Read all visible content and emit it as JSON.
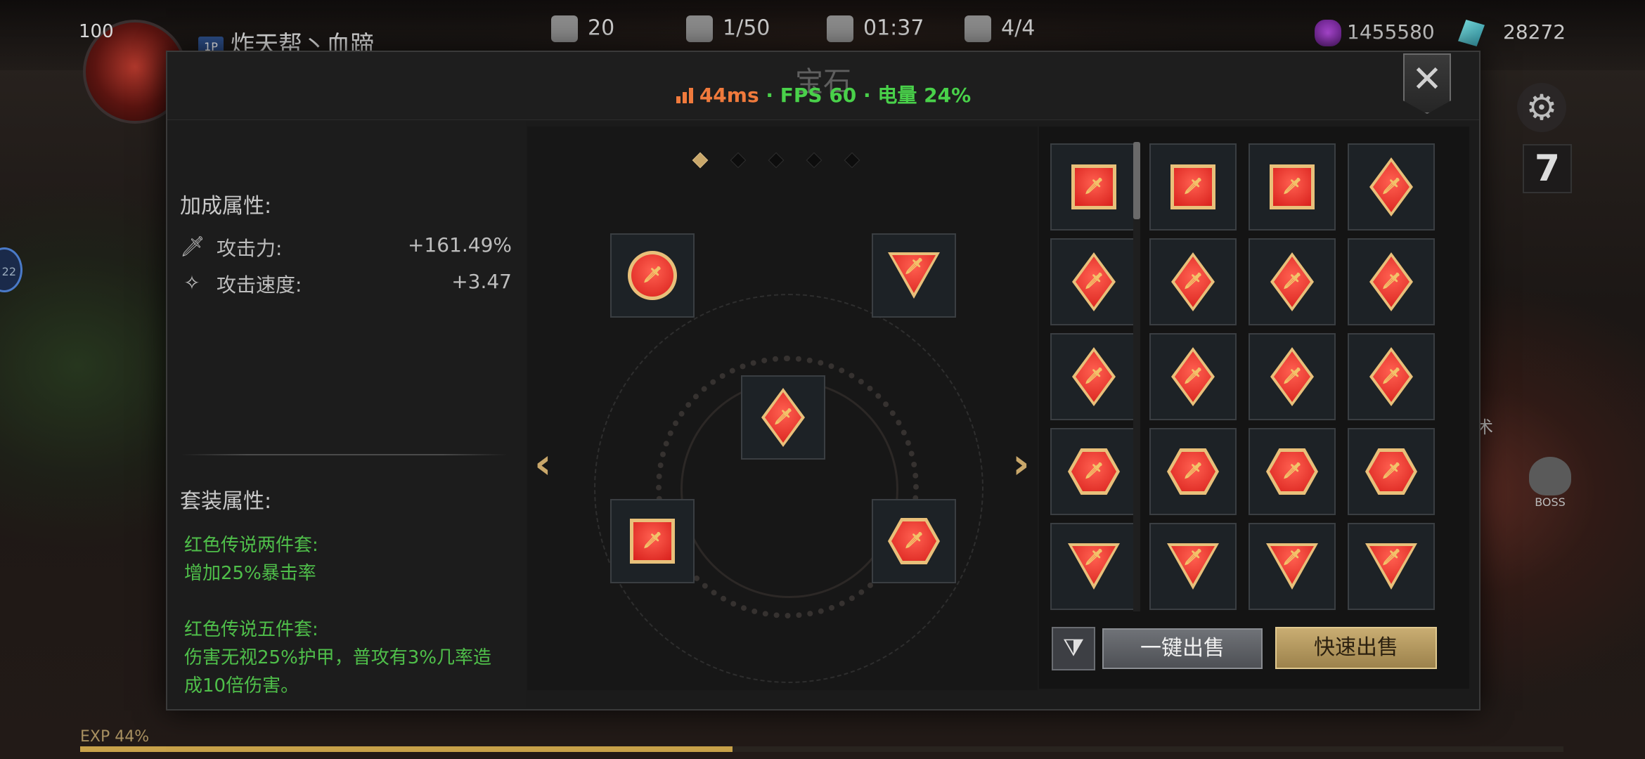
{
  "hud": {
    "level": "100",
    "guild_tag": "1P",
    "guild_name": "炸天帮丶血蹄",
    "stats": [
      {
        "icon": "fist-icon",
        "value": "20"
      },
      {
        "icon": "heart-icon",
        "value": "1/50"
      },
      {
        "icon": "crossed-swords-icon",
        "value": "01:37"
      },
      {
        "icon": "demon-mask-icon",
        "value": "4/4"
      }
    ],
    "currency_purple": "1455580",
    "currency_teal": "28272",
    "side_number": "7",
    "boss_label": "BOSS",
    "skill_label": "术",
    "left_badge": "22",
    "exp_label": "EXP 44%",
    "exp_percent": 44
  },
  "modal": {
    "title": "宝石",
    "perf_ping": "44ms",
    "perf_rest": " · FPS 60 · 电量 24%",
    "close_label": "✕"
  },
  "bonus": {
    "title": "加成属性:",
    "stats": [
      {
        "icon": "sword-icon",
        "name": "攻击力:",
        "value": "+161.49%"
      },
      {
        "icon": "winged-sword-icon",
        "name": "攻击速度:",
        "value": "+3.47"
      }
    ]
  },
  "set_bonus": {
    "title": "套装属性:",
    "entries": [
      {
        "name": "红色传说两件套:",
        "desc": "增加25%暴击率"
      },
      {
        "name": "红色传说五件套:",
        "desc": "伤害无视25%护甲，普攻有3%几率造\n成10倍伤害。"
      }
    ]
  },
  "socket": {
    "page_dots": 5,
    "active_dot": 0,
    "slots": [
      {
        "pos": "top-left",
        "shape": "circle"
      },
      {
        "pos": "top-right",
        "shape": "triangle"
      },
      {
        "pos": "center",
        "shape": "diamond"
      },
      {
        "pos": "bottom-left",
        "shape": "square"
      },
      {
        "pos": "bottom-right",
        "shape": "hexagon"
      }
    ],
    "prev_arrow": "‹",
    "next_arrow": "›"
  },
  "inventory": {
    "rows": [
      [
        "square",
        "square",
        "square",
        "diamond"
      ],
      [
        "diamond",
        "diamond",
        "diamond",
        "diamond"
      ],
      [
        "diamond",
        "diamond",
        "diamond",
        "diamond"
      ],
      [
        "hexagon",
        "hexagon",
        "hexagon",
        "hexagon"
      ],
      [
        "triangle",
        "triangle",
        "triangle",
        "triangle"
      ]
    ],
    "filter_icon": "filter-icon",
    "sell_all_label": "一键出售",
    "quick_sell_label": "快速出售"
  },
  "colors": {
    "gem_red": "#d8201c",
    "gem_gold": "#e8c07a",
    "set_text_green": "#4fbf4a",
    "ping_orange": "#f07a3c",
    "fps_green": "#49d14a",
    "accent_gold": "#c9a76a"
  }
}
